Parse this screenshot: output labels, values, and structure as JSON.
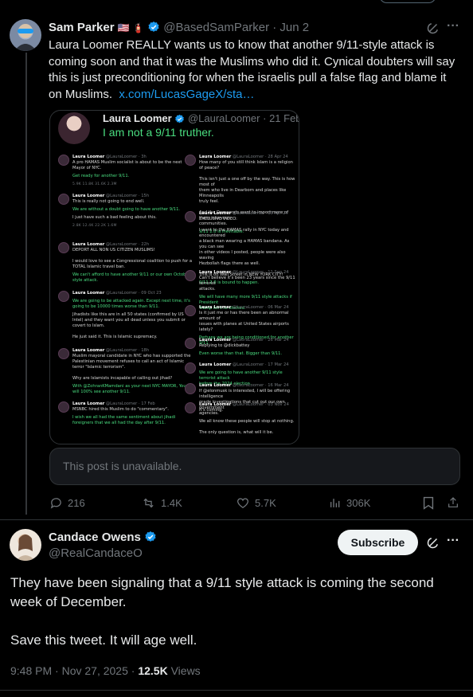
{
  "tweet1": {
    "author_name": "Sam Parker",
    "flags": "🇺🇸 🧯",
    "handle": "@BasedSamParker",
    "sep": "·",
    "date": "Jun 2",
    "text": "Laura Loomer REALLY wants us to know that another 9/11-style attack is coming soon and that it was the Muslims who did it. Cynical doubters will say this is just preconditioning for when the israelis pull a false flag and blame it on Muslims.",
    "link": "x.com/LucasGageX/sta…",
    "quote": {
      "author_name": "Laura Loomer",
      "handle": "@LauraLoomer",
      "sep": "·",
      "date": "21 Feb",
      "text": "I am not a 9/11 truther."
    },
    "unavailable": "This post is unavailable.",
    "stats": {
      "replies": "216",
      "reposts": "1.4K",
      "likes": "5.7K",
      "views": "306K"
    }
  },
  "tweet2": {
    "author_name": "Candace Owens",
    "handle": "@RealCandaceO",
    "subscribe": "Subscribe",
    "para1": "They have been signaling that a 9/11 style attack is coming the second week of December.",
    "para2": "Save this tweet. It will age well.",
    "time": "9:48 PM",
    "sep": "·",
    "date": "Nov 27, 2025",
    "sep2": "·",
    "views_count": "12.5K",
    "views_label": "Views"
  },
  "mini_left": [
    {
      "name": "Laura Loomer",
      "handle": "@LauraLoomer · 3h",
      "lines": [
        "A pro HAMAS Muslim socialist is about to be the next",
        "Mayor of NYC."
      ],
      "green": [
        "Get ready for another 9/11."
      ],
      "stats": "5.9K   11.8K   31.6K   2.3M"
    },
    {
      "name": "Laura Loomer",
      "handle": "@LauraLoomer · 15h",
      "lines": [
        "This is really not going to end well."
      ],
      "green": [
        "We are without a doubt going to have another 9/11."
      ],
      "extra": [
        "I just have such a bad feeling about this."
      ],
      "stats": "2.8K   12.4K   22.2K   1.6M"
    },
    {
      "name": "Laura Loomer",
      "handle": "@LauraLoomer · 22h",
      "lines": [
        "DEPORT ALL NON US CITIZEN MUSLIMS!",
        "",
        "I would love to see a Congressional coalition to push for a",
        "TOTAL Islamic travel ban."
      ],
      "green": [
        "We can't afford to have another 9/11 or our own October 7",
        "style attack."
      ]
    },
    {
      "name": "Laura Loomer",
      "handle": "@LauraLoomer · 09 Oct 23",
      "lines": [],
      "green": [
        "We are going to be attacked again. Except next time, it's",
        "going to be 10000 times worse than 9/11."
      ],
      "extra": [
        "Jihadists like this are in all 50 states (confirmed by US",
        "Intel) and they want you all dead unless you submit or",
        "covert to Islam.",
        "",
        "He just said it. This is Islamic supremacy."
      ]
    },
    {
      "name": "Laura Loomer",
      "handle": "@LauraLoomer · 18h",
      "lines": [
        "Muslim mayoral candidate in NYC who has supported the",
        "Palestinian movement refuses to call an act of Islamic",
        "terror \"Islamic terrorism\".",
        "",
        "Why are Islamists incapable of calling out jihad?"
      ],
      "green": [
        "With @ZohranKMamdani as your next NYC MAYOR, You",
        "will 100% see another 9/11."
      ]
    },
    {
      "name": "Laura Loomer",
      "handle": "@LauraLoomer · 17 Feb",
      "lines": [
        "MSNBC hired this Muslim to do \"commentary\"."
      ],
      "green": [
        "I wish we all had the same sentiment about jihadi",
        "foreigners that we all had the day after 9/11."
      ]
    }
  ],
  "mini_right": [
    {
      "name": "Laura Loomer",
      "handle": "@LauraLoomer · 28 Apr 24",
      "lines": [
        "How many of you still think Islam is a religion of peace?",
        "",
        "This isn't just a one off by the way. This is how most of",
        "them who live in Dearborn and places like Minneapolis",
        "truly feel.",
        "",
        "And the Democrats want to import more of them into your",
        "communities."
      ],
      "green": [
        "9/11 2.0 is inevitable."
      ]
    },
    {
      "name": "Laura Loomer",
      "handle": "@LauraLoomer · 15 Apr 24",
      "lines": [
        "EXCLUSIVE VIDEO:",
        "",
        "I went to the HAMAS rally in NYC today and encountered",
        "a black man wearing a HAMAS bandana. As you can see",
        "in other videos I posted, people were also waving",
        "Hezbollah flags there as well.",
        "",
        "This is on Wall Street in NEW YORK CITY!"
      ],
      "green": [
        "9/11 2.0 is bound to happen."
      ]
    },
    {
      "name": "Laura Loomer",
      "handle": "@LauraLoomer · 11 Sep 24",
      "lines": [
        "Can't believe it's been 23 years since the 9/11 terrorist",
        "attacks."
      ],
      "green": [
        "We will have many more 9/11 style attacks if President",
        "Trump isn't re-elected."
      ]
    },
    {
      "name": "Laura Loomer",
      "handle": "@LauraLoomer · 06 Mar 24",
      "lines": [
        "Is it just me or has there been an abnormal amount of",
        "issues with planes at United States airports lately?"
      ],
      "green": [
        "Perhaps we are being conditioned for another 9/11."
      ]
    },
    {
      "name": "Laura Loomer",
      "handle": "@LauraLoomer · 26 Mar 24",
      "lines": [
        "Replying to @dickbattey"
      ],
      "green": [
        "Even worse than that. Bigger than 9/11."
      ]
    },
    {
      "name": "Laura Loomer",
      "handle": "@LauraLoomer · 17 Mar 24",
      "lines": [],
      "green": [
        "We are going to have another 9/11 style terrorist attack",
        "before the 2024 election."
      ]
    },
    {
      "name": "Laura Loomer",
      "handle": "@LauraLoomer · 16 Mar 24",
      "lines": [
        "If @elonmusk is interested, I will be offering intelligence",
        "grade investigations that cut out our own government",
        "agencies."
      ]
    },
    {
      "name": "Laura Loomer",
      "handle": "@LauraLoomer · 03 Nov 24",
      "lines": [
        "It's coming.",
        "",
        "We all know these people will stop at nothing.",
        "",
        "The only question is, what will it be."
      ]
    }
  ]
}
